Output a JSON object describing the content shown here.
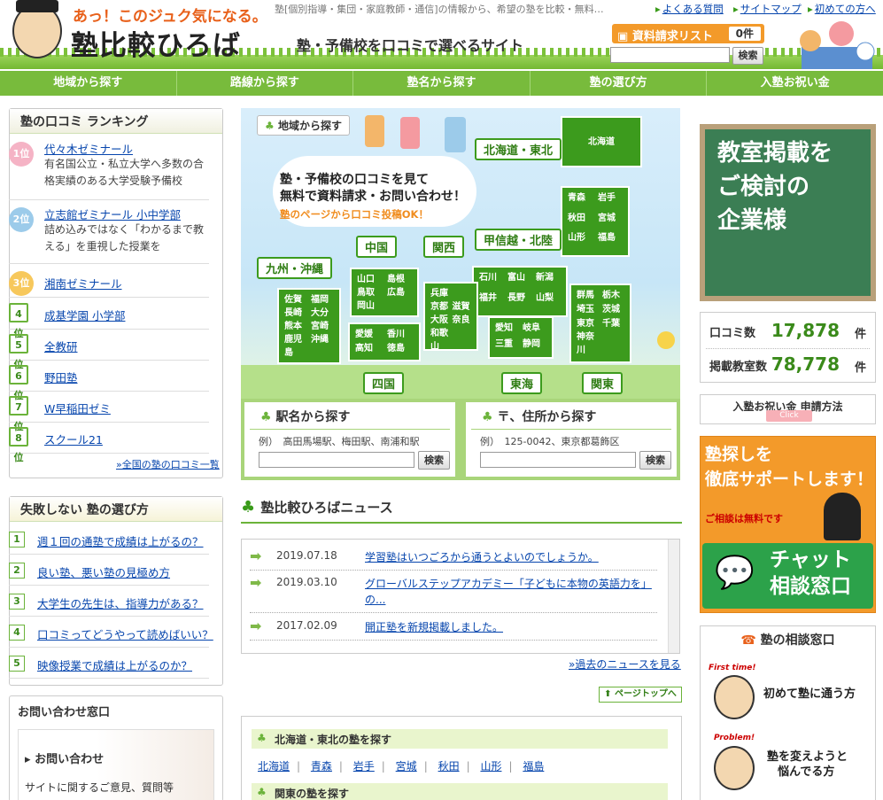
{
  "header": {
    "catch": "あっ！このジュク気になる。",
    "title": "塾比較ひろば",
    "description": "塾[個別指導・集団・家庭教師・通信]の情報から、希望の塾を比較・無料…",
    "subtitle": "塾・予備校を口コミで選べるサイト",
    "links": [
      "よくある質問",
      "サイトマップ",
      "初めての方へ"
    ],
    "doc_request": "資料請求リスト",
    "doc_count": "0件",
    "search_button": "検索"
  },
  "nav": [
    "地域から探す",
    "路線から探す",
    "塾名から探す",
    "塾の選び方",
    "入塾お祝い金"
  ],
  "ranking": {
    "title": "塾の口コミ ランキング",
    "items": [
      {
        "rank": "1位",
        "name": "代々木ゼミナール",
        "desc": "有名国公立・私立大学へ多数の合格実績のある大学受験予備校"
      },
      {
        "rank": "2位",
        "name": "立志館ゼミナール 小中学部",
        "desc": "詰め込みではなく「わかるまで教える」を重視した授業を"
      },
      {
        "rank": "3位",
        "name": "湘南ゼミナール",
        "desc": ""
      },
      {
        "rank": "4位",
        "name": "成基学園 小学部",
        "desc": ""
      },
      {
        "rank": "5位",
        "name": "全教研",
        "desc": ""
      },
      {
        "rank": "6位",
        "name": "野田塾",
        "desc": ""
      },
      {
        "rank": "7位",
        "name": "W早稲田ゼミ",
        "desc": ""
      },
      {
        "rank": "8位",
        "name": "スクール21",
        "desc": ""
      }
    ],
    "more": "»全国の塾の口コミ一覧"
  },
  "guide": {
    "title": "失敗しない 塾の選び方",
    "items": [
      {
        "n": "1",
        "text": "週１回の通塾で成績は上がるの？"
      },
      {
        "n": "2",
        "text": "良い塾、悪い塾の見極め方"
      },
      {
        "n": "3",
        "text": "大学生の先生は、指導力がある？"
      },
      {
        "n": "4",
        "text": "口コミってどうやって読めばいい？"
      },
      {
        "n": "5",
        "text": "映像授業で成績は上がるのか？"
      }
    ]
  },
  "inquiry": {
    "title": "お問い合わせ窓口",
    "label": "お問い合わせ",
    "text": "サイトに関するご意見、質問等"
  },
  "map": {
    "header": "地域から探す",
    "cloud_line1": "塾・予備校の口コミを見て",
    "cloud_line2": "無料で資料請求・お問い合わせ！",
    "cloud_line3": "塾のページから口コミ投稿OK！",
    "regions": {
      "hokkaido_tohoku": "北海道・東北",
      "chugoku": "中国",
      "kansai": "関西",
      "koshinetsu": "甲信越・北陸",
      "kyushu": "九州・沖縄",
      "shikoku": "四国",
      "tokai": "東海",
      "kanto": "関東"
    },
    "prefs": {
      "hokkaido": "北海道",
      "tohoku": [
        "青森",
        "岩手",
        "秋田",
        "宮城",
        "山形",
        "福島"
      ],
      "koshinetsu": [
        "石川",
        "富山",
        "新潟",
        "福井",
        "長野",
        "山梨"
      ],
      "kansai": [
        "兵庫",
        "京都",
        "滋賀",
        "大阪",
        "奈良",
        "和歌山"
      ],
      "chugoku": [
        "山口",
        "島根",
        "鳥取",
        "広島",
        "岡山"
      ],
      "kyushu": [
        "佐賀",
        "福岡",
        "長崎",
        "大分",
        "熊本",
        "宮崎",
        "鹿児島",
        "沖縄"
      ],
      "shikoku": [
        "愛媛",
        "香川",
        "高知",
        "徳島"
      ],
      "tokai": [
        "愛知",
        "岐阜",
        "三重",
        "静岡"
      ],
      "kanto": [
        "群馬",
        "栃木",
        "埼玉",
        "茨城",
        "東京",
        "千葉",
        "神奈川"
      ]
    }
  },
  "station_search": {
    "title": "駅名から探す",
    "example": "例）　高田馬場駅、梅田駅、南浦和駅",
    "button": "検索"
  },
  "address_search": {
    "title": "〒、住所から探す",
    "example": "例）　125-0042、東京都葛飾区",
    "button": "検索"
  },
  "news": {
    "title": "塾比較ひろばニュース",
    "items": [
      {
        "date": "2019.07.18",
        "title": "学習塾はいつごろから通うとよいのでしょうか。"
      },
      {
        "date": "2019.03.10",
        "title": "グローバルステップアカデミー「子どもに本物の英語力を」の..."
      },
      {
        "date": "2017.02.09",
        "title": "開正塾を新規掲載しました。"
      }
    ],
    "more": "»過去のニュースを見る",
    "page_top": "ページトップへ"
  },
  "region_list": {
    "tohoku_title": "北海道・東北の塾を探す",
    "tohoku_prefs": [
      "北海道",
      "青森",
      "岩手",
      "宮城",
      "秋田",
      "山形",
      "福島"
    ],
    "kanto_title": "関東の塾を探す"
  },
  "sidebar": {
    "chalk_line1": "教室掲載を",
    "chalk_line2": "ご検討の",
    "chalk_line3": "企業様",
    "reviews_label": "口コミ数",
    "reviews_value": "17,878",
    "reviews_unit": "件",
    "rooms_label": "掲載教室数",
    "rooms_value": "78,778",
    "rooms_unit": "件",
    "iwai": "入塾お祝い金 申請方法",
    "iwai_click": "Click",
    "support_line1": "塾探しを",
    "support_line2": "徹底サポートします！",
    "support_free": "ご相談は無料です",
    "chat_line1": "チャット",
    "chat_line2": "相談窓口",
    "consult_title": "塾の相談窓口",
    "consult1_tag": "First time!",
    "consult1": "初めて塾に通う方",
    "consult2_tag": "Problem!",
    "consult2_l1": "塾を変えようと",
    "consult2_l2": "悩んでる方"
  },
  "colors": {
    "green": "#78bb3c",
    "dark_green": "#3c9b1d",
    "orange": "#f39a2a",
    "link": "#0645ad"
  }
}
